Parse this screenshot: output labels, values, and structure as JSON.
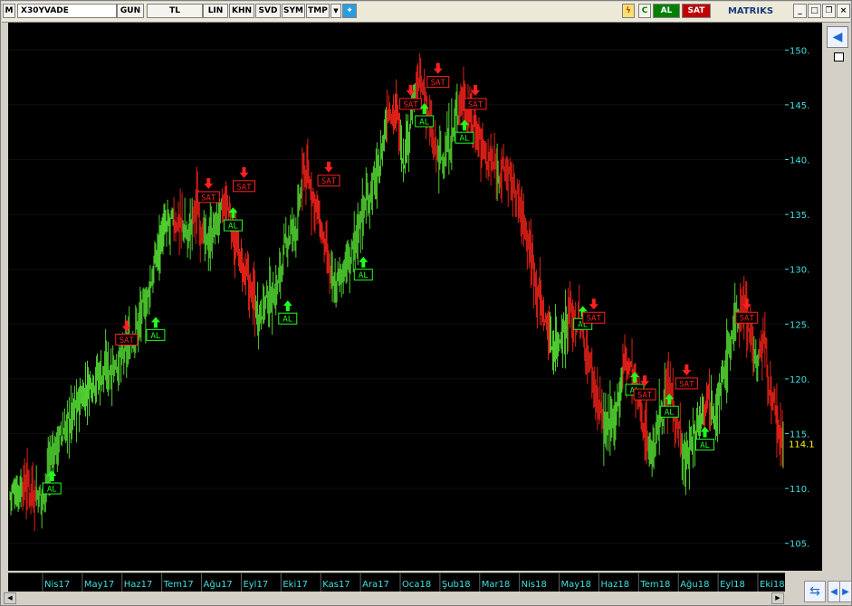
{
  "toolbar": {
    "m_label": "M",
    "symbol": "X30YVADE",
    "buttons": [
      "GUN",
      "TL",
      "LIN",
      "KHN",
      "SVD",
      "SYM",
      "TMP"
    ],
    "buy_label": "AL",
    "sell_label": "SAT",
    "brand": "MATRIKS"
  },
  "colors": {
    "up": "#50d030",
    "down": "#e02018",
    "axis_text": "#40e0e0",
    "last_price": "#ffff00",
    "signal_buy": "#20ff20",
    "signal_sell": "#ff2020"
  },
  "chart_data": {
    "type": "bar",
    "title": "",
    "xlabel": "",
    "ylabel": "",
    "ylim": [
      102.5,
      152.5
    ],
    "y_ticks": [
      105,
      110,
      115,
      120,
      125,
      130,
      135,
      140,
      145,
      150
    ],
    "x_tick_labels": [
      "Nis17",
      "May17",
      "Haz17",
      "Tem17",
      "Ağu17",
      "Eyl17",
      "Eki17",
      "Kas17",
      "Ara17",
      "Oca18",
      "Şub18",
      "Mar18",
      "Nis18",
      "May18",
      "Haz18",
      "Tem18",
      "Ağu18",
      "Eyl18",
      "Eki18"
    ],
    "last_price": "114.1",
    "series_anchors": [
      {
        "i": 0,
        "v": 109.5
      },
      {
        "i": 18,
        "v": 110.5
      },
      {
        "i": 35,
        "v": 109
      },
      {
        "i": 45,
        "v": 113
      },
      {
        "i": 70,
        "v": 117
      },
      {
        "i": 90,
        "v": 120
      },
      {
        "i": 110,
        "v": 121
      },
      {
        "i": 125,
        "v": 122
      },
      {
        "i": 135,
        "v": 124
      },
      {
        "i": 150,
        "v": 127
      },
      {
        "i": 165,
        "v": 133
      },
      {
        "i": 175,
        "v": 134
      },
      {
        "i": 185,
        "v": 134.5
      },
      {
        "i": 195,
        "v": 133
      },
      {
        "i": 205,
        "v": 136
      },
      {
        "i": 215,
        "v": 132
      },
      {
        "i": 225,
        "v": 134
      },
      {
        "i": 238,
        "v": 136
      },
      {
        "i": 245,
        "v": 133
      },
      {
        "i": 255,
        "v": 130
      },
      {
        "i": 265,
        "v": 128
      },
      {
        "i": 272,
        "v": 126
      },
      {
        "i": 280,
        "v": 127
      },
      {
        "i": 292,
        "v": 128
      },
      {
        "i": 305,
        "v": 133
      },
      {
        "i": 315,
        "v": 134
      },
      {
        "i": 322,
        "v": 139
      },
      {
        "i": 328,
        "v": 138
      },
      {
        "i": 335,
        "v": 136
      },
      {
        "i": 345,
        "v": 132
      },
      {
        "i": 355,
        "v": 128
      },
      {
        "i": 365,
        "v": 130
      },
      {
        "i": 375,
        "v": 131
      },
      {
        "i": 385,
        "v": 135
      },
      {
        "i": 395,
        "v": 137
      },
      {
        "i": 405,
        "v": 139
      },
      {
        "i": 415,
        "v": 145
      },
      {
        "i": 425,
        "v": 144
      },
      {
        "i": 432,
        "v": 140
      },
      {
        "i": 440,
        "v": 144
      },
      {
        "i": 448,
        "v": 147
      },
      {
        "i": 455,
        "v": 146
      },
      {
        "i": 465,
        "v": 141
      },
      {
        "i": 475,
        "v": 140
      },
      {
        "i": 485,
        "v": 142
      },
      {
        "i": 495,
        "v": 146
      },
      {
        "i": 505,
        "v": 144
      },
      {
        "i": 515,
        "v": 142
      },
      {
        "i": 525,
        "v": 140
      },
      {
        "i": 535,
        "v": 139
      },
      {
        "i": 545,
        "v": 139
      },
      {
        "i": 555,
        "v": 137
      },
      {
        "i": 565,
        "v": 134
      },
      {
        "i": 575,
        "v": 130
      },
      {
        "i": 585,
        "v": 126
      },
      {
        "i": 595,
        "v": 123
      },
      {
        "i": 605,
        "v": 124
      },
      {
        "i": 615,
        "v": 126
      },
      {
        "i": 625,
        "v": 125
      },
      {
        "i": 635,
        "v": 122
      },
      {
        "i": 645,
        "v": 118
      },
      {
        "i": 655,
        "v": 115
      },
      {
        "i": 665,
        "v": 117
      },
      {
        "i": 675,
        "v": 122
      },
      {
        "i": 685,
        "v": 120
      },
      {
        "i": 695,
        "v": 116
      },
      {
        "i": 705,
        "v": 113
      },
      {
        "i": 715,
        "v": 117
      },
      {
        "i": 725,
        "v": 119
      },
      {
        "i": 735,
        "v": 115
      },
      {
        "i": 740,
        "v": 112
      },
      {
        "i": 748,
        "v": 114
      },
      {
        "i": 755,
        "v": 116
      },
      {
        "i": 765,
        "v": 119
      },
      {
        "i": 775,
        "v": 117
      },
      {
        "i": 785,
        "v": 121
      },
      {
        "i": 795,
        "v": 125
      },
      {
        "i": 805,
        "v": 127
      },
      {
        "i": 812,
        "v": 125
      },
      {
        "i": 820,
        "v": 121
      },
      {
        "i": 828,
        "v": 124
      },
      {
        "i": 835,
        "v": 118
      },
      {
        "i": 842,
        "v": 116
      },
      {
        "i": 849,
        "v": 113
      }
    ],
    "signals": [
      {
        "type": "AL",
        "i": 46,
        "v": 110.5
      },
      {
        "type": "SAT",
        "i": 128,
        "v": 123.5
      },
      {
        "type": "AL",
        "i": 160,
        "v": 124.5
      },
      {
        "type": "SAT",
        "i": 218,
        "v": 136.5
      },
      {
        "type": "AL",
        "i": 245,
        "v": 134.5
      },
      {
        "type": "SAT",
        "i": 257,
        "v": 137.5
      },
      {
        "type": "AL",
        "i": 305,
        "v": 126
      },
      {
        "type": "SAT",
        "i": 350,
        "v": 138
      },
      {
        "type": "AL",
        "i": 388,
        "v": 130
      },
      {
        "type": "SAT",
        "i": 440,
        "v": 145
      },
      {
        "type": "AL",
        "i": 455,
        "v": 144
      },
      {
        "type": "SAT",
        "i": 470,
        "v": 147
      },
      {
        "type": "AL",
        "i": 499,
        "v": 142.5
      },
      {
        "type": "SAT",
        "i": 511,
        "v": 145
      },
      {
        "type": "AL",
        "i": 629,
        "v": 125.5
      },
      {
        "type": "SAT",
        "i": 641,
        "v": 125.5
      },
      {
        "type": "AL",
        "i": 686,
        "v": 119.5
      },
      {
        "type": "SAT",
        "i": 697,
        "v": 118.5
      },
      {
        "type": "AL",
        "i": 724,
        "v": 117.5
      },
      {
        "type": "SAT",
        "i": 743,
        "v": 119.5
      },
      {
        "type": "AL",
        "i": 763,
        "v": 114.5
      },
      {
        "type": "SAT",
        "i": 809,
        "v": 125.5
      }
    ]
  }
}
